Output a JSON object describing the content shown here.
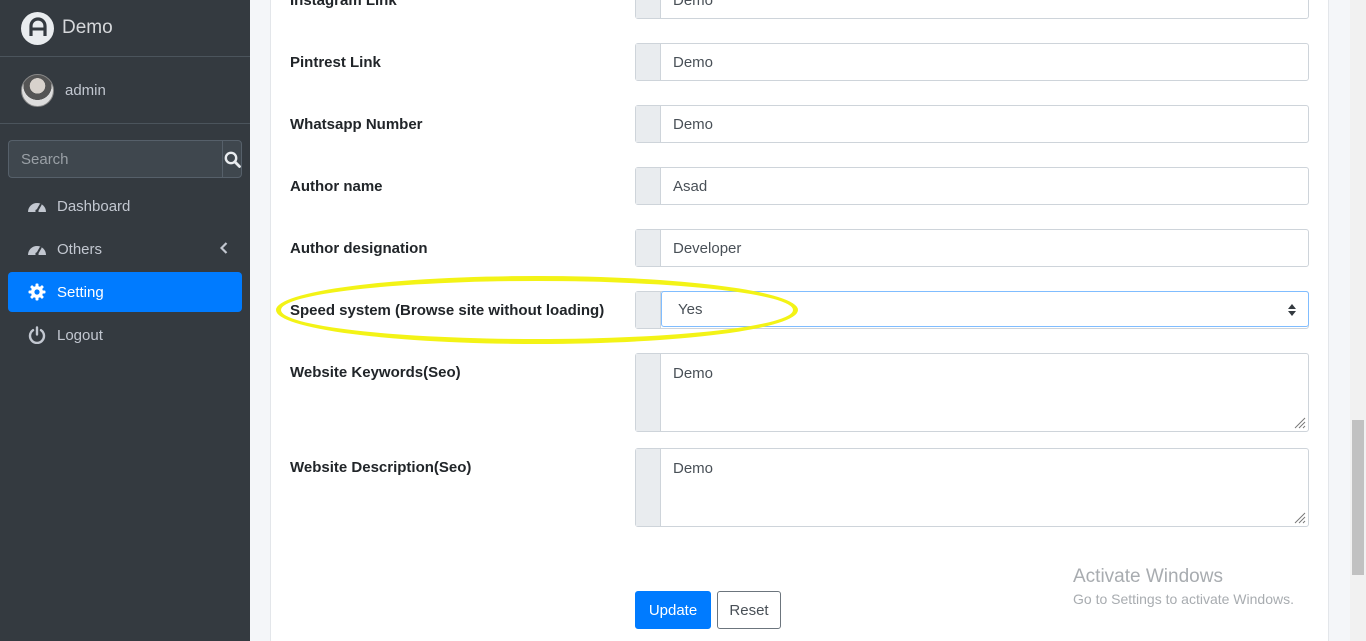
{
  "brand": {
    "name": "Demo"
  },
  "user": {
    "name": "admin"
  },
  "search": {
    "placeholder": "Search"
  },
  "nav": [
    {
      "label": "Dashboard",
      "icon": "tachometer-icon"
    },
    {
      "label": "Others",
      "icon": "tachometer-icon"
    },
    {
      "label": "Setting",
      "icon": "gear-icon"
    },
    {
      "label": "Logout",
      "icon": "power-icon"
    }
  ],
  "form": {
    "instagram": {
      "label": "Instagram Link",
      "value": "Demo"
    },
    "pintrest": {
      "label": "Pintrest Link",
      "value": "Demo"
    },
    "whatsapp": {
      "label": "Whatsapp Number",
      "value": "Demo"
    },
    "author_name": {
      "label": "Author name",
      "value": "Asad"
    },
    "author_designation": {
      "label": "Author designation",
      "value": "Developer"
    },
    "speed_system": {
      "label": "Speed system (Browse site without loading)",
      "value": "Yes"
    },
    "keywords": {
      "label": "Website Keywords(Seo)",
      "value": "Demo"
    },
    "description": {
      "label": "Website Description(Seo)",
      "value": "Demo"
    },
    "update_label": "Update",
    "reset_label": "Reset"
  },
  "watermark": {
    "title": "Activate Windows",
    "subtitle": "Go to Settings to activate Windows."
  },
  "colors": {
    "sidebar_bg": "#343a40",
    "accent": "#007bff",
    "highlight": "#f3f316"
  }
}
